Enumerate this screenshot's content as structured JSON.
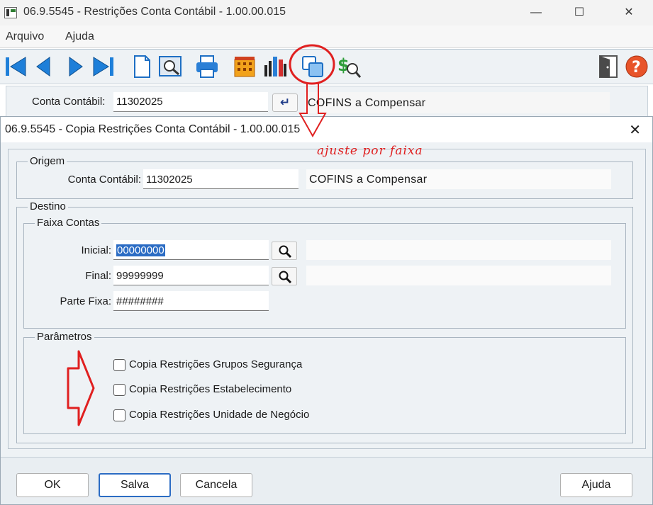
{
  "window": {
    "title": "06.9.5545 - Restrições Conta Contábil - 1.00.00.015",
    "minimize": "—",
    "maximize": "☐",
    "close": "✕"
  },
  "menu": {
    "items": [
      {
        "label": "Arquivo"
      },
      {
        "label": "Ajuda"
      }
    ]
  },
  "toolbar": {
    "icons": [
      "first-record-icon",
      "previous-record-icon",
      "next-record-icon",
      "last-record-icon",
      "new-document-icon",
      "preview-icon",
      "print-icon",
      "building-icon",
      "chart-icon",
      "copy-icon",
      "money-search-icon",
      "exit-door-icon",
      "help-icon"
    ]
  },
  "background_form": {
    "account_label": "Conta Contábil:",
    "account_value": "11302025",
    "account_desc": "COFINS a Compensar"
  },
  "dialog": {
    "title": "06.9.5545 - Copia Restrições Conta Contábil - 1.00.00.015",
    "origem": {
      "legend": "Origem",
      "account_label": "Conta Contábil:",
      "account_value": "11302025",
      "account_desc": "COFINS a Compensar"
    },
    "destino": {
      "legend": "Destino",
      "faixa_legend": "Faixa Contas",
      "inicial_label": "Inicial:",
      "inicial_value": "00000000",
      "final_label": "Final:",
      "final_value": "99999999",
      "parte_fixa_label": "Parte Fixa:",
      "parte_fixa_value": "########"
    },
    "parametros": {
      "legend": "Parâmetros",
      "checkboxes": [
        {
          "label": "Copia Restrições Grupos Segurança",
          "checked": false
        },
        {
          "label": "Copia Restrições Estabelecimento",
          "checked": false
        },
        {
          "label": "Copia Restrições Unidade de Negócio",
          "checked": false
        }
      ]
    },
    "buttons": {
      "ok": "OK",
      "salva": "Salva",
      "cancela": "Cancela",
      "ajuda": "Ajuda"
    }
  },
  "annotation": {
    "text": "ajuste por faixa",
    "color": "#e02020"
  }
}
